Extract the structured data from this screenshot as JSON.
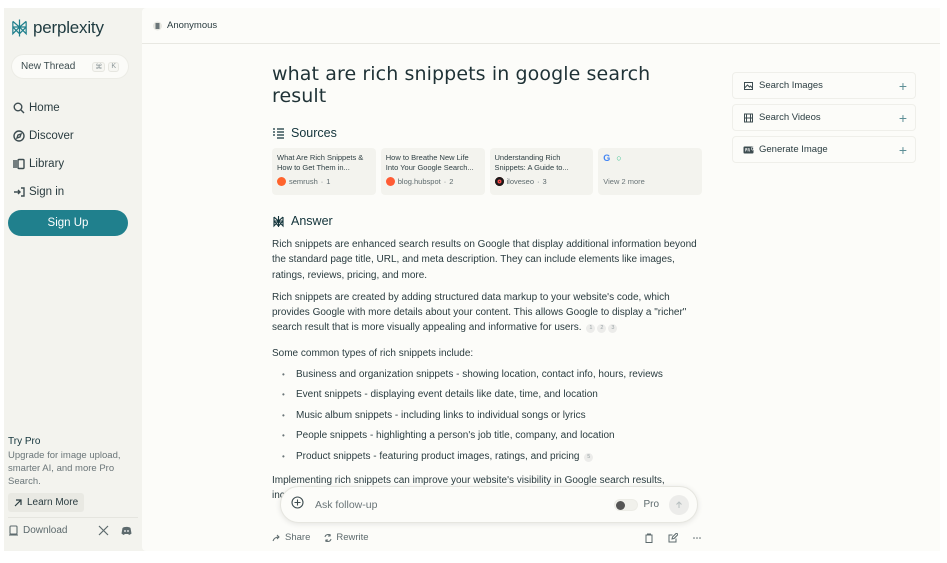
{
  "app": {
    "name": "perplexity",
    "brand_color": "#20808d"
  },
  "sidebar": {
    "new_thread": {
      "label": "New Thread",
      "shortcut": [
        "⌘",
        "K"
      ]
    },
    "nav": [
      {
        "label": "Home",
        "icon": "search-icon"
      },
      {
        "label": "Discover",
        "icon": "compass-icon"
      },
      {
        "label": "Library",
        "icon": "library-icon"
      },
      {
        "label": "Sign in",
        "icon": "sign-in-icon"
      }
    ],
    "signup_label": "Sign Up",
    "try_pro": {
      "title": "Try Pro",
      "description": "Upgrade for image upload, smarter AI, and more Pro Search.",
      "learn_more": "Learn More"
    },
    "download_label": "Download"
  },
  "topbar": {
    "user_label": "Anonymous"
  },
  "thread": {
    "query": "what are rich snippets in google search result",
    "sources_label": "Sources",
    "sources": [
      {
        "title": "What Are Rich Snippets & How to Get Them in...",
        "site": "semrush",
        "index": "1",
        "color": "#ff642d"
      },
      {
        "title": "How to Breathe New Life Into Your Google Search...",
        "site": "blog.hubspot",
        "index": "2",
        "color": "#ff5c35"
      },
      {
        "title": "Understanding Rich Snippets: A Guide to...",
        "site": "iloveseo",
        "index": "3",
        "color": "#1a1a1a"
      }
    ],
    "more_sources": {
      "label": "View 2 more",
      "icons": [
        "G",
        "○"
      ]
    },
    "answer_label": "Answer",
    "paragraphs": [
      "Rich snippets are enhanced search results on Google that display additional information beyond the standard page title, URL, and meta description. They can include elements like images, ratings, reviews, pricing, and more.",
      "Rich snippets are created by adding structured data markup to your website's code, which provides Google with more details about your content. This allows Google to display a \"richer\" search result that is more visually appealing and informative for users."
    ],
    "paragraph2_citations": [
      "1",
      "2",
      "3"
    ],
    "list_intro": "Some common types of rich snippets include:",
    "bullets": [
      "Business and organization snippets - showing location, contact info, hours, reviews",
      "Event snippets - displaying event details like date, time, and location",
      "Music album snippets - including links to individual songs or lyrics",
      "People snippets - highlighting a person's job title, company, and location",
      "Product snippets - featuring product images, ratings, and pricing"
    ],
    "last_bullet_citation": "5",
    "closing": "Implementing rich snippets can improve your website's visibility in Google search results, increase click-through rates, and drive more organic traffic. To get rich snippets"
  },
  "followup": {
    "placeholder": "Ask follow-up",
    "pro_label": "Pro",
    "pro_enabled": false
  },
  "actions": {
    "share": "Share",
    "rewrite": "Rewrite"
  },
  "right_panel": [
    {
      "label": "Search Images",
      "icon": "image-icon"
    },
    {
      "label": "Search Videos",
      "icon": "video-icon"
    },
    {
      "label": "Generate Image",
      "icon": "pro-icon"
    }
  ]
}
